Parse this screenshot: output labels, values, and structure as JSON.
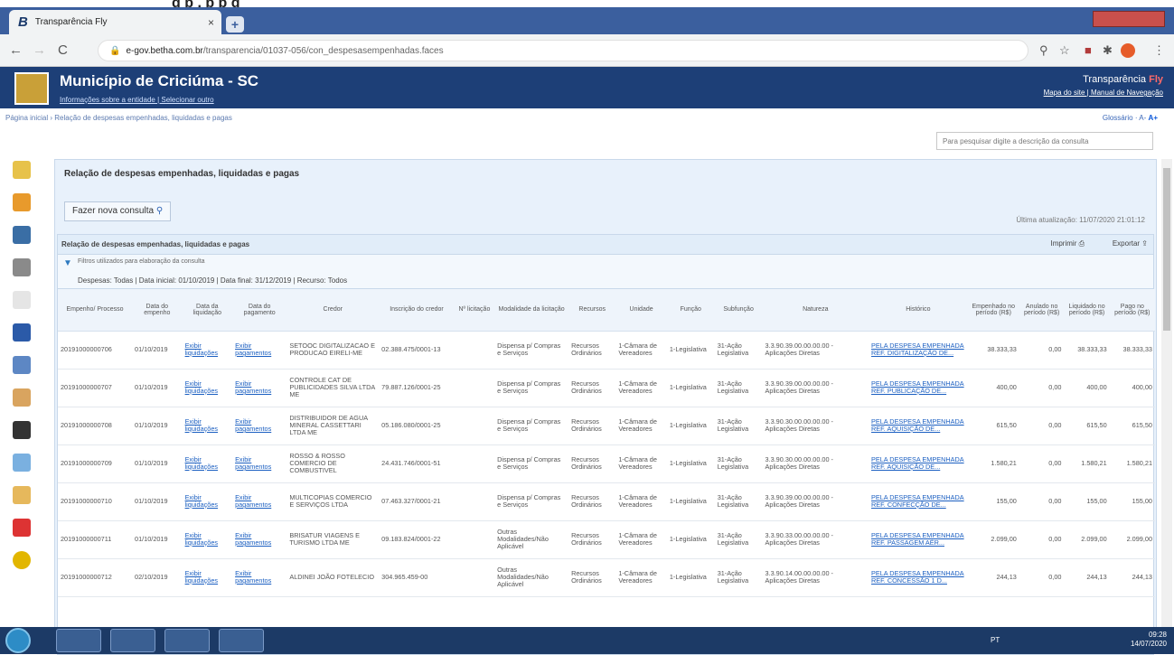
{
  "top_strip": "g         p       ,  p          p g",
  "browser": {
    "tab_title": "Transparência Fly",
    "tab_icon": "B",
    "tab_close": "×",
    "new_tab": "+",
    "back": "←",
    "forward": "→",
    "reload": "C",
    "url_domain": "e-gov.betha.com.br",
    "url_path": "/transparencia/01037-056/con_despesasempenhadas.faces"
  },
  "site": {
    "municipio": "Município de Criciúma - SC",
    "links": "Informações sobre a entidade | Selecionar outro",
    "transparencia": "Transparência",
    "fly": "Fly",
    "mapa": "Mapa do site | Manual de Navegação"
  },
  "breadcrumb": "Página inicial  ›  Relação de despesas empenhadas, liquidadas e pagas",
  "glossario": "Glossário  ·  A-",
  "glossario_a": "A+",
  "search_placeholder": "Para pesquisar digite a descrição da consulta",
  "page": {
    "title": "Relação de despesas empenhadas, liquidadas e pagas",
    "nova_consulta": "Fazer nova consulta",
    "ultima_atualizacao": "Última atualização: 11/07/2020 21:01:12",
    "panel_title": "Relação de despesas empenhadas, liquidadas e pagas",
    "imprimir": "Imprimir",
    "exportar": "Exportar",
    "filtros_titulo": "Filtros utilizados para elaboração da consulta",
    "filtros": "Despesas: Todas | Data inicial: 01/10/2019 | Data final: 31/12/2019 | Recurso: Todos"
  },
  "table": {
    "headers": [
      "Empenho/ Processo",
      "Data do empenho",
      "Data da liquidação",
      "Data do pagamento",
      "Credor",
      "Inscrição do credor",
      "Nº licitação",
      "Modalidade da licitação",
      "Recursos",
      "Unidade",
      "Função",
      "Subfunção",
      "Natureza",
      "Histórico",
      "Empenhado no período (R$)",
      "Anulado no período (R$)",
      "Liquidado no período (R$)",
      "Pago no período (R$)"
    ],
    "rows": [
      [
        "20191000000706",
        "01/10/2019",
        "Exibir liquidações",
        "Exibir pagamentos",
        "SETOOC DIGITALIZACAO E PRODUCAO EIRELI-ME",
        "02.388.475/0001-13",
        "",
        "Dispensa p/ Compras e Serviços",
        "Recursos Ordinários",
        "1-Câmara de Vereadores",
        "1-Legislativa",
        "31-Ação Legislativa",
        "3.3.90.39.00.00.00.00 - Aplicações Diretas",
        "PELA DESPESA EMPENHADA REF. DIGITALIZAÇÃO DE...",
        "38.333,33",
        "0,00",
        "38.333,33",
        "38.333,33"
      ],
      [
        "20191000000707",
        "01/10/2019",
        "Exibir liquidações",
        "Exibir pagamentos",
        "CONTROLE CAT DE PUBLICIDADES SILVA LTDA ME",
        "79.887.126/0001-25",
        "",
        "Dispensa p/ Compras e Serviços",
        "Recursos Ordinários",
        "1-Câmara de Vereadores",
        "1-Legislativa",
        "31-Ação Legislativa",
        "3.3.90.39.00.00.00.00 - Aplicações Diretas",
        "PELA DESPESA EMPENHADA REF. PUBLICAÇÃO DE...",
        "400,00",
        "0,00",
        "400,00",
        "400,00"
      ],
      [
        "20191000000708",
        "01/10/2019",
        "Exibir liquidações",
        "Exibir pagamentos",
        "DISTRIBUIDOR DE AGUA MINERAL CASSETTARI LTDA ME",
        "05.186.080/0001-25",
        "",
        "Dispensa p/ Compras e Serviços",
        "Recursos Ordinários",
        "1-Câmara de Vereadores",
        "1-Legislativa",
        "31-Ação Legislativa",
        "3.3.90.30.00.00.00.00 - Aplicações Diretas",
        "PELA DESPESA EMPENHADA REF. AQUISIÇÃO DE...",
        "615,50",
        "0,00",
        "615,50",
        "615,50"
      ],
      [
        "20191000000709",
        "01/10/2019",
        "Exibir liquidações",
        "Exibir pagamentos",
        "ROSSO & ROSSO COMERCIO DE COMBUSTIVEL",
        "24.431.746/0001-51",
        "",
        "Dispensa p/ Compras e Serviços",
        "Recursos Ordinários",
        "1-Câmara de Vereadores",
        "1-Legislativa",
        "31-Ação Legislativa",
        "3.3.90.30.00.00.00.00 - Aplicações Diretas",
        "PELA DESPESA EMPENHADA REF. AQUISIÇÃO DE...",
        "1.580,21",
        "0,00",
        "1.580,21",
        "1.580,21"
      ],
      [
        "20191000000710",
        "01/10/2019",
        "Exibir liquidações",
        "Exibir pagamentos",
        "MULTICOPIAS COMERCIO E SERVIÇOS LTDA",
        "07.463.327/0001-21",
        "",
        "Dispensa p/ Compras e Serviços",
        "Recursos Ordinários",
        "1-Câmara de Vereadores",
        "1-Legislativa",
        "31-Ação Legislativa",
        "3.3.90.39.00.00.00.00 - Aplicações Diretas",
        "PELA DESPESA EMPENHADA REF. CONFECÇÃO DE...",
        "155,00",
        "0,00",
        "155,00",
        "155,00"
      ],
      [
        "20191000000711",
        "01/10/2019",
        "Exibir liquidações",
        "Exibir pagamentos",
        "BRISATUR VIAGENS E TURISMO LTDA ME",
        "09.183.824/0001-22",
        "",
        "Outras Modalidades/Não Aplicável",
        "Recursos Ordinários",
        "1-Câmara de Vereadores",
        "1-Legislativa",
        "31-Ação Legislativa",
        "3.3.90.33.00.00.00.00 - Aplicações Diretas",
        "PELA DESPESA EMPENHADA REF. PASSAGEM AÉR...",
        "2.099,00",
        "0,00",
        "2.099,00",
        "2.099,00"
      ],
      [
        "20191000000712",
        "02/10/2019",
        "Exibir liquidações",
        "Exibir pagamentos",
        "ALDINEI JOÃO FOTELECIO",
        "304.965.459-00",
        "",
        "Outras Modalidades/Não Aplicável",
        "Recursos Ordinários",
        "1-Câmara de Vereadores",
        "1-Legislativa",
        "31-Ação Legislativa",
        "3.3.90.14.00.00.00.00 - Aplicações Diretas",
        "PELA DESPESA EMPENHADA REF. CONCESSÃO 1 D...",
        "244,13",
        "0,00",
        "244,13",
        "244,13"
      ]
    ]
  },
  "taskbar": {
    "lang": "PT",
    "time": "09:28",
    "date": "14/07/2020"
  }
}
